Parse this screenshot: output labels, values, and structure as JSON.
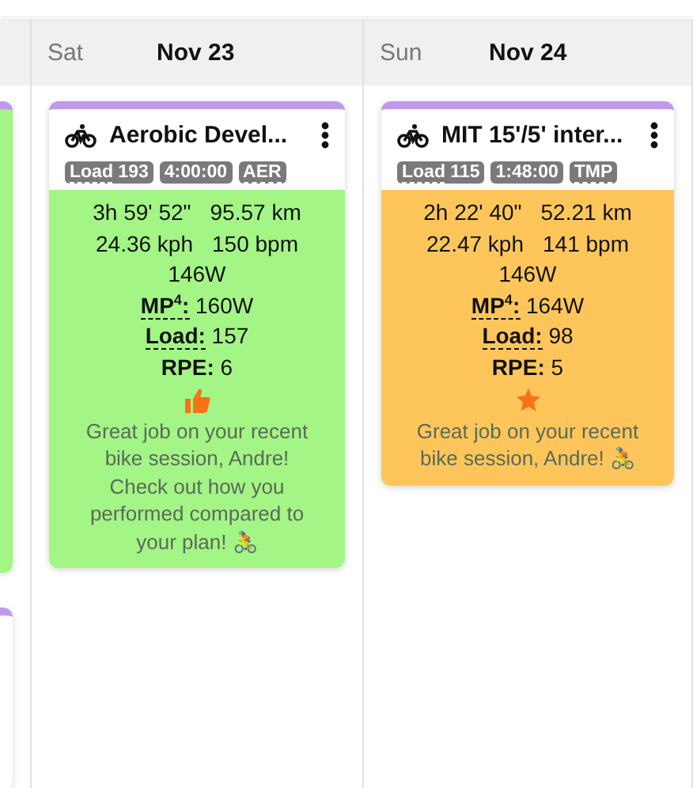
{
  "days": [
    {
      "weekday": "Sat",
      "date": "Nov 23",
      "workouts": [
        {
          "title": "Aerobic Devel...",
          "color": "#a3f585",
          "badges": [
            {
              "kind": "load",
              "label": "Load",
              "value": "193"
            },
            {
              "kind": "duration",
              "text": "4:00:00"
            },
            {
              "kind": "zone",
              "text": "AER"
            }
          ],
          "stats": [
            [
              "3h 59' 52\"",
              "95.57 km"
            ],
            [
              "24.36 kph",
              "150 bpm"
            ],
            [
              "146W"
            ]
          ],
          "metrics": [
            {
              "label": "MP$^{4}$:",
              "value": "160W",
              "underlined": true
            },
            {
              "label": "Load:",
              "value": "157",
              "underlined": true
            },
            {
              "label": "RPE:",
              "value": "6",
              "underlined": false
            }
          ],
          "feedback": {
            "kind": "thumbs-up"
          },
          "message": "Great job on your recent bike session, Andre! Check out how you performed compared to your plan! 🚴"
        }
      ]
    },
    {
      "weekday": "Sun",
      "date": "Nov 24",
      "workouts": [
        {
          "title": "MIT 15'/5' inter...",
          "color": "#fec65a",
          "badges": [
            {
              "kind": "load",
              "label": "Load",
              "value": "115"
            },
            {
              "kind": "duration",
              "text": "1:48:00"
            },
            {
              "kind": "zone",
              "text": "TMP"
            }
          ],
          "stats": [
            [
              "2h 22' 40\"",
              "52.21 km"
            ],
            [
              "22.47 kph",
              "141 bpm"
            ],
            [
              "146W"
            ]
          ],
          "metrics": [
            {
              "label": "MP$^{4}$:",
              "value": "164W",
              "underlined": true
            },
            {
              "label": "Load:",
              "value": "98",
              "underlined": true
            },
            {
              "label": "RPE:",
              "value": "5",
              "underlined": false
            }
          ],
          "feedback": {
            "kind": "star"
          },
          "message": "Great job on your recent bike session, Andre! 🚴"
        }
      ]
    }
  ]
}
